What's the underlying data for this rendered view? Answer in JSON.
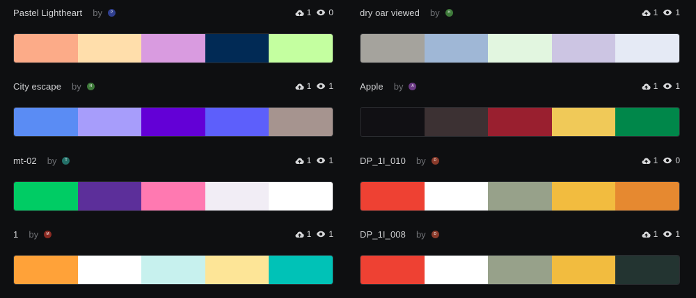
{
  "palettes": [
    {
      "name": "Pastel Lightheart",
      "by": "by",
      "avatar_letter": "P",
      "avatar_color": "#2f3f8f",
      "downloads": "1",
      "views": "0",
      "colors": [
        "#fcab88",
        "#ffdeab",
        "#d99be0",
        "#012a55",
        "#c4ffa0"
      ]
    },
    {
      "name": "dry oar viewed",
      "by": "by",
      "avatar_letter": "H",
      "avatar_color": "#3e7a3a",
      "downloads": "1",
      "views": "1",
      "colors": [
        "#a5a39d",
        "#9fb7d6",
        "#e2f6e0",
        "#ccc5e3",
        "#e5eaf5"
      ]
    },
    {
      "name": "City escape",
      "by": "by",
      "avatar_letter": "H",
      "avatar_color": "#3e7a3a",
      "downloads": "1",
      "views": "1",
      "colors": [
        "#5a8cf4",
        "#a79dfb",
        "#6300d6",
        "#5d5ffb",
        "#a6948f"
      ]
    },
    {
      "name": "Apple",
      "by": "by",
      "avatar_letter": "A",
      "avatar_color": "#6b3a85",
      "downloads": "1",
      "views": "1",
      "colors": [
        "#111014",
        "#3c3133",
        "#991f2f",
        "#f0c958",
        "#00874a"
      ]
    },
    {
      "name": "mt-02",
      "by": "by",
      "avatar_letter": "T",
      "avatar_color": "#237068",
      "downloads": "1",
      "views": "1",
      "colors": [
        "#00cc64",
        "#5c2f9a",
        "#ff79b1",
        "#f1edf5",
        "#ffffff"
      ]
    },
    {
      "name": "DP_1I_010",
      "by": "by",
      "avatar_letter": "D",
      "avatar_color": "#8a3a2a",
      "downloads": "1",
      "views": "0",
      "colors": [
        "#ee4133",
        "#ffffff",
        "#97a18a",
        "#f2bc3f",
        "#e68930"
      ]
    },
    {
      "name": "1",
      "by": "by",
      "avatar_letter": "M",
      "avatar_color": "#8a2a22",
      "downloads": "1",
      "views": "1",
      "colors": [
        "#ffa239",
        "#ffffff",
        "#c7f1ee",
        "#fde597",
        "#00c2b7"
      ]
    },
    {
      "name": "DP_1I_008",
      "by": "by",
      "avatar_letter": "D",
      "avatar_color": "#8a3a2a",
      "downloads": "1",
      "views": "1",
      "colors": [
        "#ee4133",
        "#ffffff",
        "#97a18a",
        "#f2bc3f",
        "#233431"
      ]
    }
  ]
}
